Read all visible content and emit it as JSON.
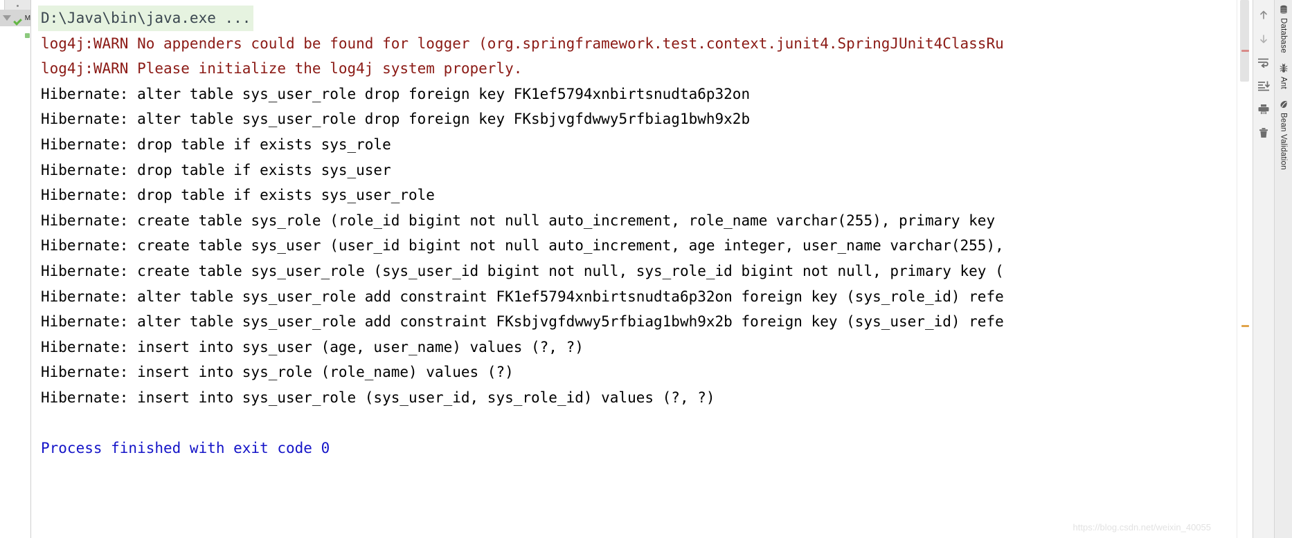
{
  "test_tree": {
    "collapse_triangle": "collapse-all-triangle",
    "status_icon": "green-check-icon",
    "node_label": "M"
  },
  "console": {
    "lines": [
      {
        "text": "D:\\Java\\bin\\java.exe ...",
        "style": "cmd"
      },
      {
        "text": "log4j:WARN No appenders could be found for logger (org.springframework.test.context.junit4.SpringJUnit4ClassRu",
        "style": "warn"
      },
      {
        "text": "log4j:WARN Please initialize the log4j system properly.",
        "style": "warn"
      },
      {
        "text": "Hibernate: alter table sys_user_role drop foreign key FK1ef5794xnbirtsnudta6p32on",
        "style": "sql"
      },
      {
        "text": "Hibernate: alter table sys_user_role drop foreign key FKsbjvgfdwwy5rfbiag1bwh9x2b",
        "style": "sql"
      },
      {
        "text": "Hibernate: drop table if exists sys_role",
        "style": "sql"
      },
      {
        "text": "Hibernate: drop table if exists sys_user",
        "style": "sql"
      },
      {
        "text": "Hibernate: drop table if exists sys_user_role",
        "style": "sql"
      },
      {
        "text": "Hibernate: create table sys_role (role_id bigint not null auto_increment, role_name varchar(255), primary key ",
        "style": "sql"
      },
      {
        "text": "Hibernate: create table sys_user (user_id bigint not null auto_increment, age integer, user_name varchar(255),",
        "style": "sql"
      },
      {
        "text": "Hibernate: create table sys_user_role (sys_user_id bigint not null, sys_role_id bigint not null, primary key (",
        "style": "sql"
      },
      {
        "text": "Hibernate: alter table sys_user_role add constraint FK1ef5794xnbirtsnudta6p32on foreign key (sys_role_id) refe",
        "style": "sql"
      },
      {
        "text": "Hibernate: alter table sys_user_role add constraint FKsbjvgfdwwy5rfbiag1bwh9x2b foreign key (sys_user_id) refe",
        "style": "sql"
      },
      {
        "text": "Hibernate: insert into sys_user (age, user_name) values (?, ?)",
        "style": "sql"
      },
      {
        "text": "Hibernate: insert into sys_role (role_name) values (?)",
        "style": "sql"
      },
      {
        "text": "Hibernate: insert into sys_user_role (sys_user_id, sys_role_id) values (?, ?)",
        "style": "sql"
      },
      {
        "text": " ",
        "style": "blank"
      },
      {
        "text": "Process finished with exit code 0",
        "style": "exit"
      }
    ],
    "colors": {
      "command": "#3b4750",
      "command_bg": "#e6f3e0",
      "warn": "#8b1a15",
      "sql": "#000000",
      "exit": "#1414c8"
    }
  },
  "toolbar": {
    "buttons": [
      {
        "name": "up-arrow-icon",
        "title": "Up"
      },
      {
        "name": "down-arrow-icon",
        "title": "Down"
      },
      {
        "name": "soft-wrap-icon",
        "title": "Soft-Wrap"
      },
      {
        "name": "scroll-to-end-icon",
        "title": "Scroll to the end"
      },
      {
        "name": "print-icon",
        "title": "Print"
      },
      {
        "name": "trash-icon",
        "title": "Clear All"
      }
    ]
  },
  "tool_stripe": {
    "items": [
      {
        "label": "Database",
        "icon": "database-icon"
      },
      {
        "label": "Ant",
        "icon": "ant-icon"
      },
      {
        "label": "Bean Validation",
        "icon": "bean-validation-icon"
      }
    ]
  },
  "watermark": {
    "text": "https://blog.csdn.net/weixin_40055"
  }
}
